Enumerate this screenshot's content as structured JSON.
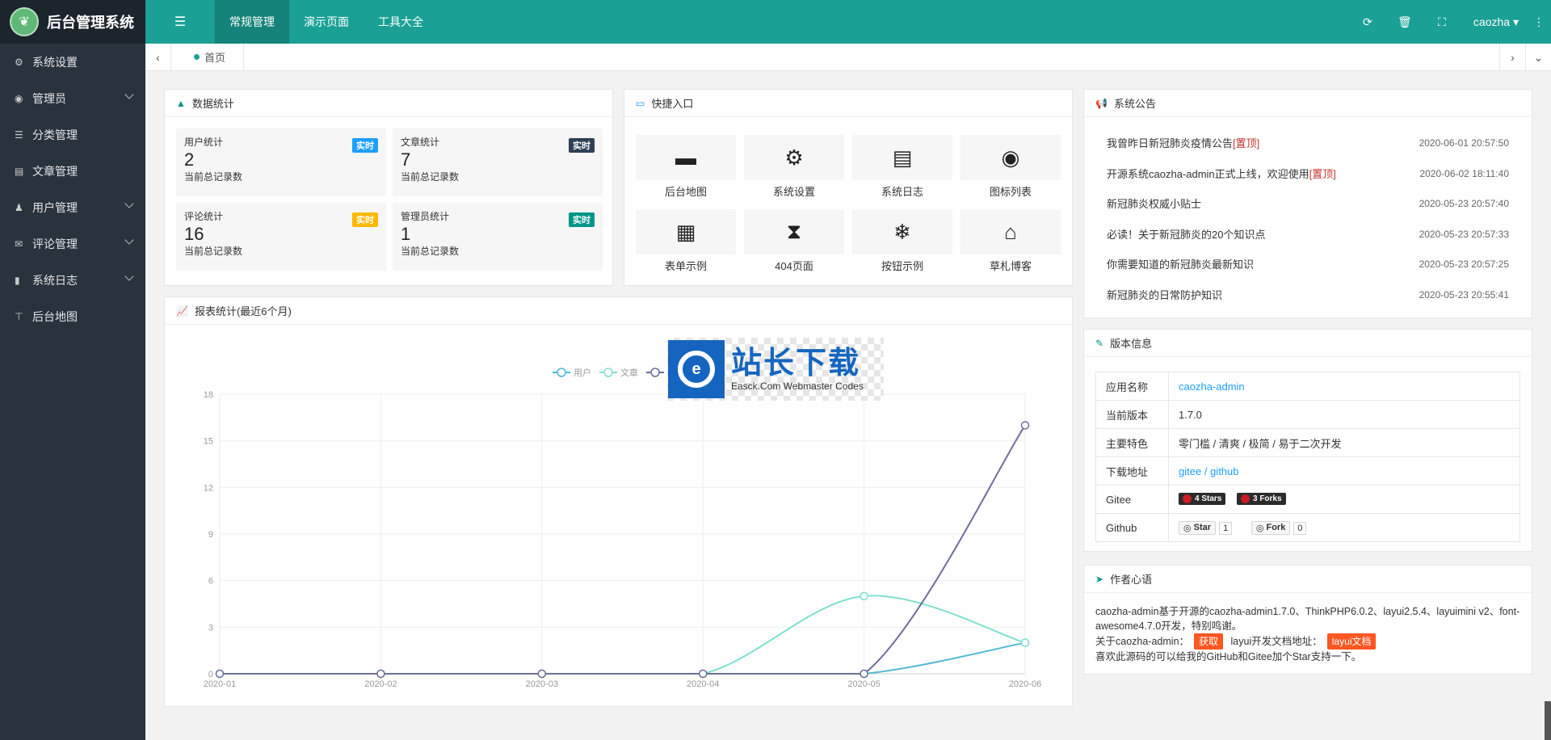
{
  "app": {
    "title": "后台管理系统"
  },
  "sidebar": {
    "items": [
      {
        "label": "系统设置",
        "icon": "gears-icon",
        "has_children": false
      },
      {
        "label": "管理员",
        "icon": "user-circle-icon",
        "has_children": true
      },
      {
        "label": "分类管理",
        "icon": "list-icon",
        "has_children": false
      },
      {
        "label": "文章管理",
        "icon": "newspaper-icon",
        "has_children": false
      },
      {
        "label": "用户管理",
        "icon": "user-icon",
        "has_children": true
      },
      {
        "label": "评论管理",
        "icon": "comment-icon",
        "has_children": true
      },
      {
        "label": "系统日志",
        "icon": "file-icon",
        "has_children": true
      },
      {
        "label": "后台地图",
        "icon": "signpost-icon",
        "has_children": false
      }
    ]
  },
  "topbar": {
    "tabs": [
      {
        "label": "常规管理",
        "active": true
      },
      {
        "label": "演示页面",
        "active": false
      },
      {
        "label": "工具大全",
        "active": false
      }
    ],
    "user": "caozha",
    "accent": "#1aa094"
  },
  "tabbar": {
    "home": "首页"
  },
  "stats": {
    "title": "数据统计",
    "items": [
      {
        "title": "用户统计",
        "value": "2",
        "sub": "当前总记录数",
        "badge": "实时",
        "badge_color": "#1e9fff"
      },
      {
        "title": "文章统计",
        "value": "7",
        "sub": "当前总记录数",
        "badge": "实时",
        "badge_color": "#2f4056"
      },
      {
        "title": "评论统计",
        "value": "16",
        "sub": "当前总记录数",
        "badge": "实时",
        "badge_color": "#ffb800"
      },
      {
        "title": "管理员统计",
        "value": "1",
        "sub": "当前总记录数",
        "badge": "实时",
        "badge_color": "#009688"
      }
    ]
  },
  "quick": {
    "title": "快捷入口",
    "items": [
      {
        "label": "后台地图",
        "icon": "window-icon"
      },
      {
        "label": "系统设置",
        "icon": "gears-icon"
      },
      {
        "label": "系统日志",
        "icon": "file-text-icon"
      },
      {
        "label": "图标列表",
        "icon": "dot-circle-icon"
      },
      {
        "label": "表单示例",
        "icon": "calendar-icon"
      },
      {
        "label": "404页面",
        "icon": "hourglass-icon"
      },
      {
        "label": "按钮示例",
        "icon": "snowflake-icon"
      },
      {
        "label": "草札博客",
        "icon": "home-icon"
      }
    ]
  },
  "notices": {
    "title": "系统公告",
    "items": [
      {
        "text": "我曾昨日新冠肺炎疫情公告",
        "top": "[置顶]",
        "time": "2020-06-01 20:57:50"
      },
      {
        "text": "开源系统caozha-admin正式上线，欢迎使用",
        "top": "[置顶]",
        "time": "2020-06-02 18:11:40"
      },
      {
        "text": "新冠肺炎权威小贴士",
        "top": "",
        "time": "2020-05-23 20:57:40"
      },
      {
        "text": "必读！关于新冠肺炎的20个知识点",
        "top": "",
        "time": "2020-05-23 20:57:33"
      },
      {
        "text": "你需要知道的新冠肺炎最新知识",
        "top": "",
        "time": "2020-05-23 20:57:25"
      },
      {
        "text": "新冠肺炎的日常防护知识",
        "top": "",
        "time": "2020-05-23 20:55:41"
      }
    ]
  },
  "version": {
    "title": "版本信息",
    "rows": {
      "name_k": "应用名称",
      "name_v": "caozha-admin",
      "ver_k": "当前版本",
      "ver_v": "1.7.0",
      "feat_k": "主要特色",
      "feat_v": "零门槛 / 清爽 / 极简 / 易于二次开发",
      "dl_k": "下载地址",
      "dl_gitee": "gitee",
      "dl_sep": "/",
      "dl_github": "github",
      "gitee_k": "Gitee",
      "gitee_stars": "4 Stars",
      "gitee_forks": "3 Forks",
      "github_k": "Github",
      "gh_star": "Star",
      "gh_star_n": "1",
      "gh_fork": "Fork",
      "gh_fork_n": "0"
    }
  },
  "author": {
    "title": "作者心语",
    "line1": "caozha-admin基于开源的caozha-admin1.7.0、ThinkPHP6.0.2、layui2.5.4、layuimini v2、font-awesome4.7.0开发，特别鸣谢。",
    "line2_a": "关于caozha-admin：",
    "line2_b": "获取",
    "line2_c": "layui开发文档地址：",
    "line2_d": "layui文档",
    "line3": "喜欢此源码的可以给我的GitHub和Gitee加个Star支持一下。"
  },
  "chart_title": "报表统计(最近6个月)",
  "watermark": {
    "big": "站长下载",
    "small": "Easck.Com Webmaster Codes",
    "logo": "e"
  },
  "chart_data": {
    "type": "line",
    "x": [
      "2020-01",
      "2020-02",
      "2020-03",
      "2020-04",
      "2020-05",
      "2020-06"
    ],
    "ylim": [
      0,
      18
    ],
    "yticks": [
      0,
      3,
      6,
      9,
      12,
      15,
      18
    ],
    "legend_position": "top-center",
    "series": [
      {
        "name": "用户",
        "values": [
          0,
          0,
          0,
          0,
          0,
          2
        ],
        "color": "#4fb8d4"
      },
      {
        "name": "文章",
        "values": [
          0,
          0,
          0,
          0,
          5,
          2
        ],
        "color": "#7fe0d0"
      },
      {
        "name": "",
        "values": [
          0,
          0,
          0,
          0,
          0,
          16
        ],
        "color": "#6b6f9a"
      }
    ]
  }
}
